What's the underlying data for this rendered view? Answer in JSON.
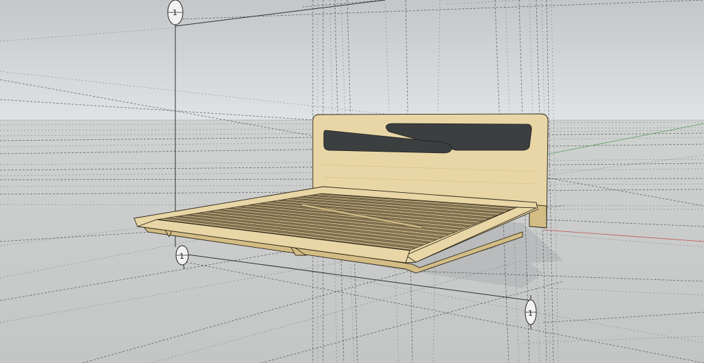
{
  "scene": {
    "colors": {
      "sky_top": "#c3c7ca",
      "sky_horizon": "#dde2e4",
      "ground": "#c9cbcb",
      "wood": "#e8d6a6",
      "wood_edge": "#2a2416",
      "slot": "#3c3f40",
      "shadow": "#b9bbbc",
      "guide": "#3a3a3a",
      "axis_red": "#c0504d",
      "axis_green": "#4f9a5a"
    },
    "grid_markers": [
      {
        "label": "1"
      },
      {
        "label": "1"
      },
      {
        "label": "1"
      }
    ],
    "model": {
      "headboard": {
        "slot_count": 2
      },
      "frame": {
        "slat_count": 16
      }
    }
  }
}
